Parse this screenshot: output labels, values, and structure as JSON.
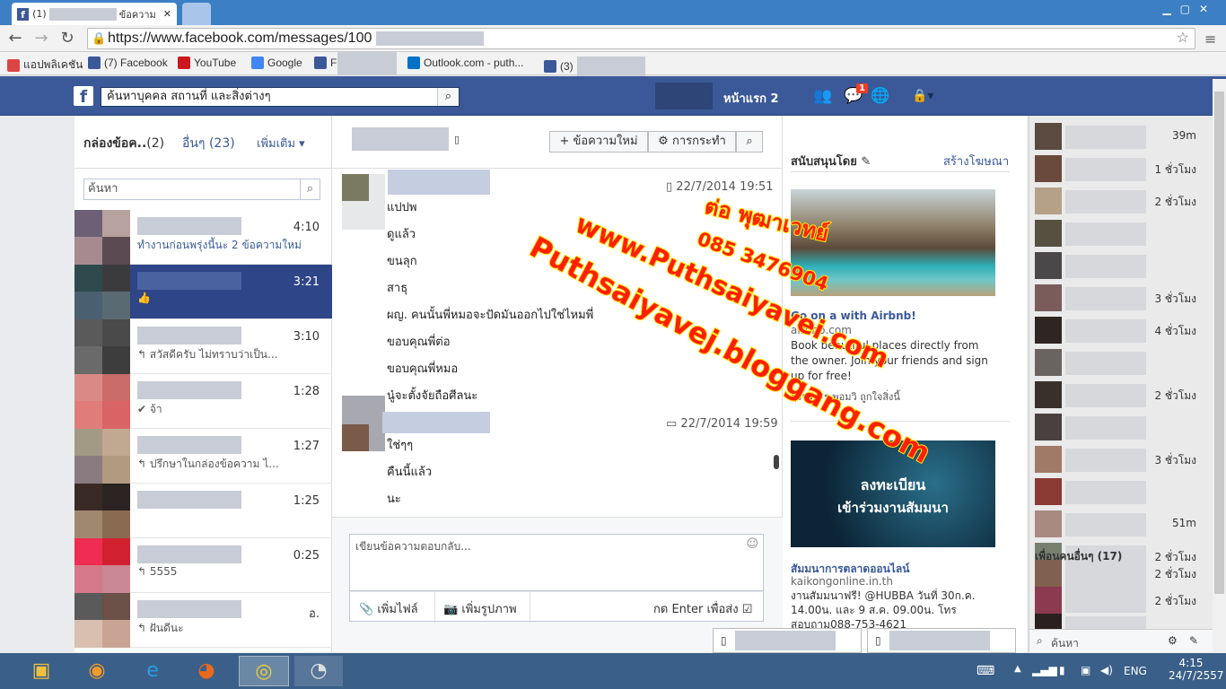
{
  "browser": {
    "tab_active_label": "(1)",
    "tab_active_title": "ข้อความ",
    "close_symbol": "✕",
    "url": "https://www.facebook.com/messages/100",
    "bookmarks": [
      {
        "label": "แอปพลิเคชัน",
        "color": "#d44"
      },
      {
        "label": "(7) Facebook",
        "color": "#3b5998"
      },
      {
        "label": "YouTube",
        "color": "#cc181e"
      },
      {
        "label": "Google",
        "color": "#4285f4"
      },
      {
        "label": "F",
        "color": "#3b5998"
      },
      {
        "label": "Outlook.com - puth...",
        "color": "#0072c6"
      },
      {
        "label": "(3)",
        "color": "#3b5998"
      }
    ]
  },
  "fb_header": {
    "logo": "f",
    "search_placeholder": "ค้นหาบุคคล สถานที่ และสิ่งต่างๆ",
    "home_label": "หน้าแรก",
    "home_count": "2",
    "message_badge": "1"
  },
  "inbox": {
    "title": "กล่องข้อค..",
    "title_count": "(2)",
    "other_label": "อื่นๆ",
    "other_count": "(23)",
    "more_label": "เพิ่มเติม",
    "search_placeholder": "ค้นหา",
    "threads": [
      {
        "time": "4:10",
        "snippet": "ทำงานก่อนพรุ่งนี้นะ 2 ข้อความใหม่",
        "selected": false,
        "colors": [
          "#6d5f75",
          "#b8a2a0",
          "#a68a90",
          "#5c4a52"
        ]
      },
      {
        "time": "3:21",
        "snippet": "👍",
        "selected": true,
        "colors": [
          "#2f4a4c",
          "#3b3b3d",
          "#4a6070",
          "#5a6a73"
        ]
      },
      {
        "time": "3:10",
        "snippet": "↰ สวัสดีครับ ไม่ทราบว่าเป็น...",
        "selected": false,
        "colors": [
          "#5a5a5a",
          "#4a4a4a",
          "#6a6a6a",
          "#3d3d3d"
        ]
      },
      {
        "time": "1:28",
        "snippet": "✔ จ้า",
        "selected": false,
        "colors": [
          "#d98a87",
          "#c96c6a",
          "#e07d7a",
          "#d86466"
        ]
      },
      {
        "time": "1:27",
        "snippet": "↰ ปรึกษาในกล่องข้อความ ไ...",
        "selected": false,
        "colors": [
          "#a39a85",
          "#c1a891",
          "#8a7b80",
          "#b29a80"
        ]
      },
      {
        "time": "1:25",
        "snippet": "",
        "selected": false,
        "colors": [
          "#3a2a26",
          "#2b2422",
          "#a08870",
          "#8a6a50"
        ]
      },
      {
        "time": "0:25",
        "snippet": "↰ 5555",
        "selected": false,
        "colors": [
          "#ef2c51",
          "#d2212e",
          "#d4788a",
          "#c98894"
        ]
      },
      {
        "time": "อ.",
        "snippet": "↰ ฝันดีนะ",
        "selected": false,
        "colors": [
          "#5a5a5a",
          "#6b5047",
          "#d8bfb0",
          "#c9a494"
        ]
      }
    ]
  },
  "conversation": {
    "new_message_label": "ข้อความใหม่",
    "actions_label": "การกระทำ",
    "blocks": [
      {
        "time": "22/7/2014 19:51",
        "messages": [
          "แปปพ",
          "ดูแล้ว",
          "ขนลุก",
          "สาธุ",
          "ผญ. คนนั้นพี่หมอจะปัดมันออกไปใช่ไหมพี่",
          "ขอบคุณพี่ต่อ",
          "ขอบคุณพี่หมอ",
          "นู๋จะตั้งจัยถือศีลนะ"
        ]
      },
      {
        "time": "22/7/2014 19:59",
        "messages": [
          "ใช่ๆๆ",
          "คืนนี้แล้ว",
          "นะ"
        ]
      }
    ],
    "reply_placeholder": "เขียนข้อความตอบกลับ...",
    "add_file_label": "เพิ่มไฟล์",
    "add_photo_label": "เพิ่มรูปภาพ",
    "enter_to_send_label": "กด Enter เพื่อส่ง"
  },
  "ads": {
    "header": "สนับสนุนโดย",
    "create_ad": "สร้างโฆษณา",
    "ad1": {
      "title_start": "Go on a",
      "title_end": "with Airbnb!",
      "domain": "airbnb.com",
      "body": "Book beautiful places directly from the owner. Join your friends and sign up for free!",
      "likes": "ฤรินทา ร พอมวิ ถูกใจสิ่งนี้"
    },
    "ad2": {
      "image_line1": "ลงทะเบียน",
      "image_line2": "เข้าร่วมงานสัมมนา",
      "title": "สัมมนาการตลาดออนไลน์",
      "domain": "kaikongonline.in.th",
      "body": "งานสัมมนาฟรี! @HUBBA วันที่ 30ก.ค. 14.00น. และ 9 ส.ค. 09.00น. โทรสอบถาม088-753-4621"
    }
  },
  "chat_sidebar": {
    "statuses": [
      "39m",
      "1 ชั่วโมง",
      "2 ชั่วโมง",
      "",
      "",
      "3 ชั่วโมง",
      "4 ชั่วโมง",
      "",
      "2 ชั่วโมง",
      "",
      "3 ชั่วโมง",
      "",
      "51m",
      "2 ชั่วโมง"
    ],
    "colors": [
      "#5a4a40",
      "#6b4a3e",
      "#b5a088",
      "#555040",
      "#4a4848",
      "#7a5c5a",
      "#2e2622",
      "#6a6460",
      "#3a302a",
      "#4a4040",
      "#a07a66",
      "#8c3a34",
      "#a88a80",
      "#7a8070",
      "#c0b0a0"
    ],
    "more_friends_label": "เพื่อนคนอื่นๆ (17)",
    "more_statuses": [
      "2 ชั่วโมง",
      "2 ชั่วโมง"
    ],
    "more_colors": [
      "#806050",
      "#8c3a50",
      "#2a2020"
    ],
    "search_placeholder": "ค้นหา"
  },
  "watermark": {
    "line1": "ต่อ พุฒาเวทย์",
    "line2": "085 3476904",
    "line3": "www.Puthsaiyavei.com",
    "line4": "Puthsaiyavej.bloggang.com"
  },
  "taskbar": {
    "language": "ENG",
    "time": "4:15",
    "date": "24/7/2557"
  }
}
